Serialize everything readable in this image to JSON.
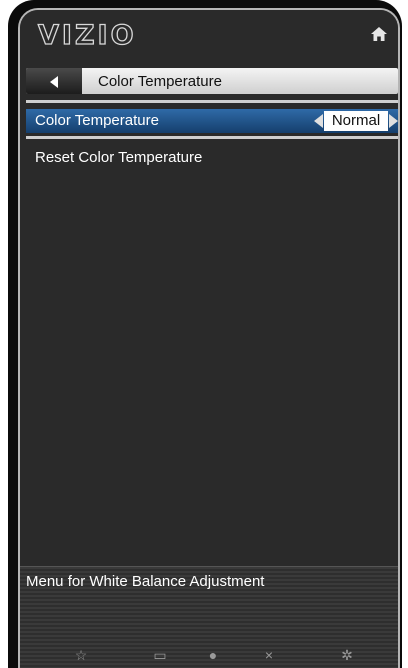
{
  "brand": {
    "logo": "VIZIO"
  },
  "header": {
    "home_icon": "home-icon"
  },
  "titlebar": {
    "back_icon": "back-arrow-icon",
    "title": "Color Temperature"
  },
  "menu": {
    "items": [
      {
        "label": "Color Temperature",
        "value": "Normal",
        "selected": true
      },
      {
        "label": "Reset Color Temperature"
      }
    ]
  },
  "footer": {
    "help_text": "Menu for White Balance Adjustment"
  },
  "bottom_icons": [
    "star-icon",
    "screen-icon",
    "vizio-v-icon",
    "close-icon",
    "settings-icon"
  ],
  "colors": {
    "selection": "#1f5590",
    "background": "#2a2a2a",
    "titlebar": "#e2e2e2"
  }
}
